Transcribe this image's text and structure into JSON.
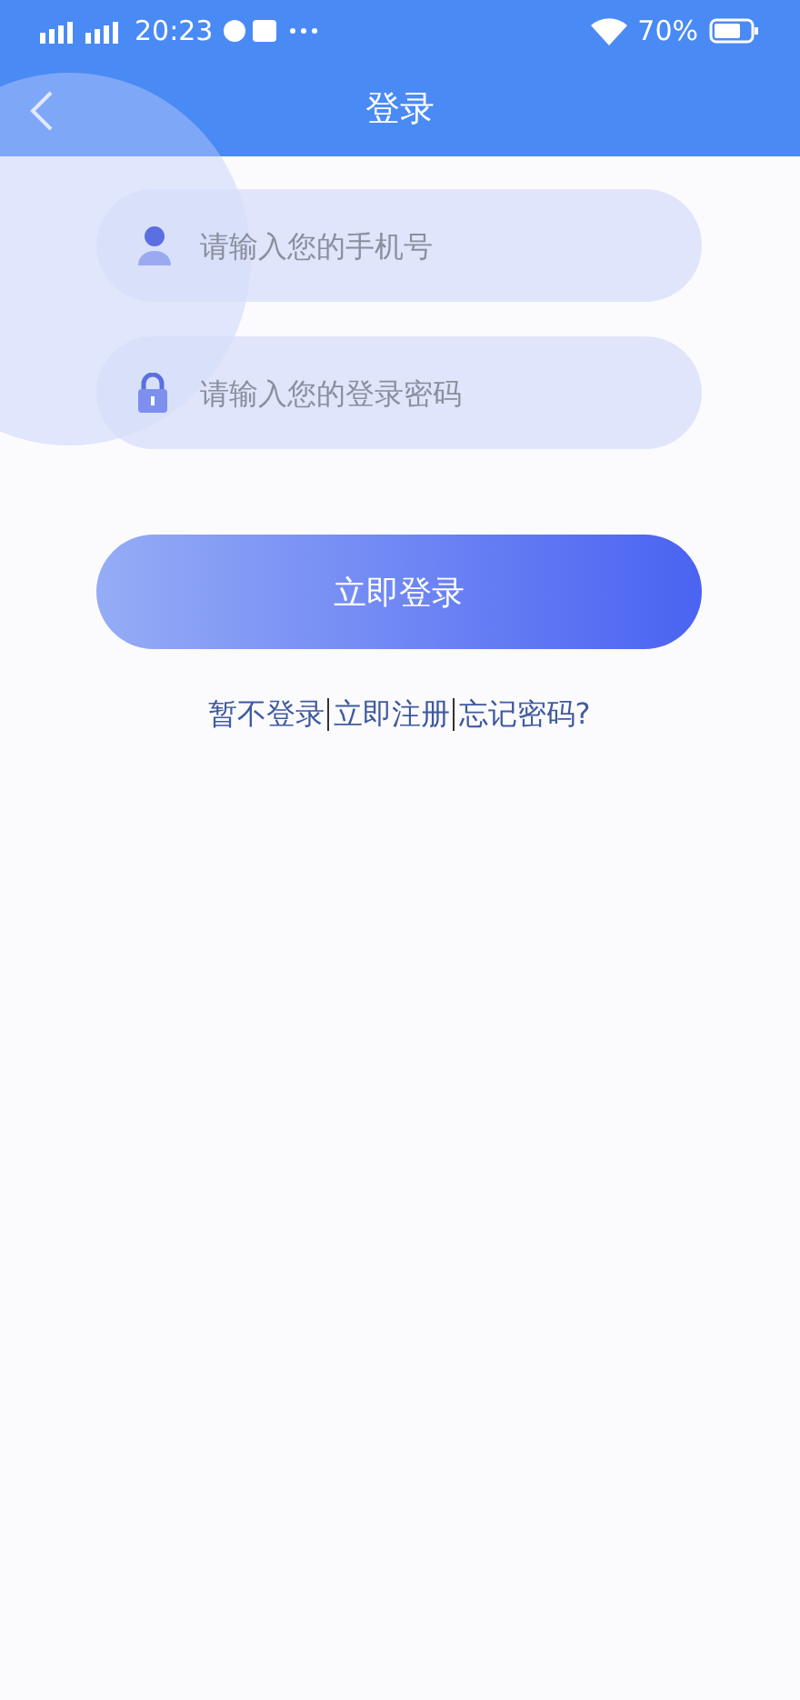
{
  "status_bar": {
    "time": "20:23",
    "battery_text": "70%"
  },
  "nav": {
    "title": "登录"
  },
  "fields": [
    {
      "kind": "phone",
      "placeholder": "请输入您的手机号"
    },
    {
      "kind": "password",
      "placeholder": "请输入您的登录密码"
    }
  ],
  "login_button": "立即登录",
  "links": [
    "暂不登录",
    "立即注册",
    "忘记密码?"
  ]
}
